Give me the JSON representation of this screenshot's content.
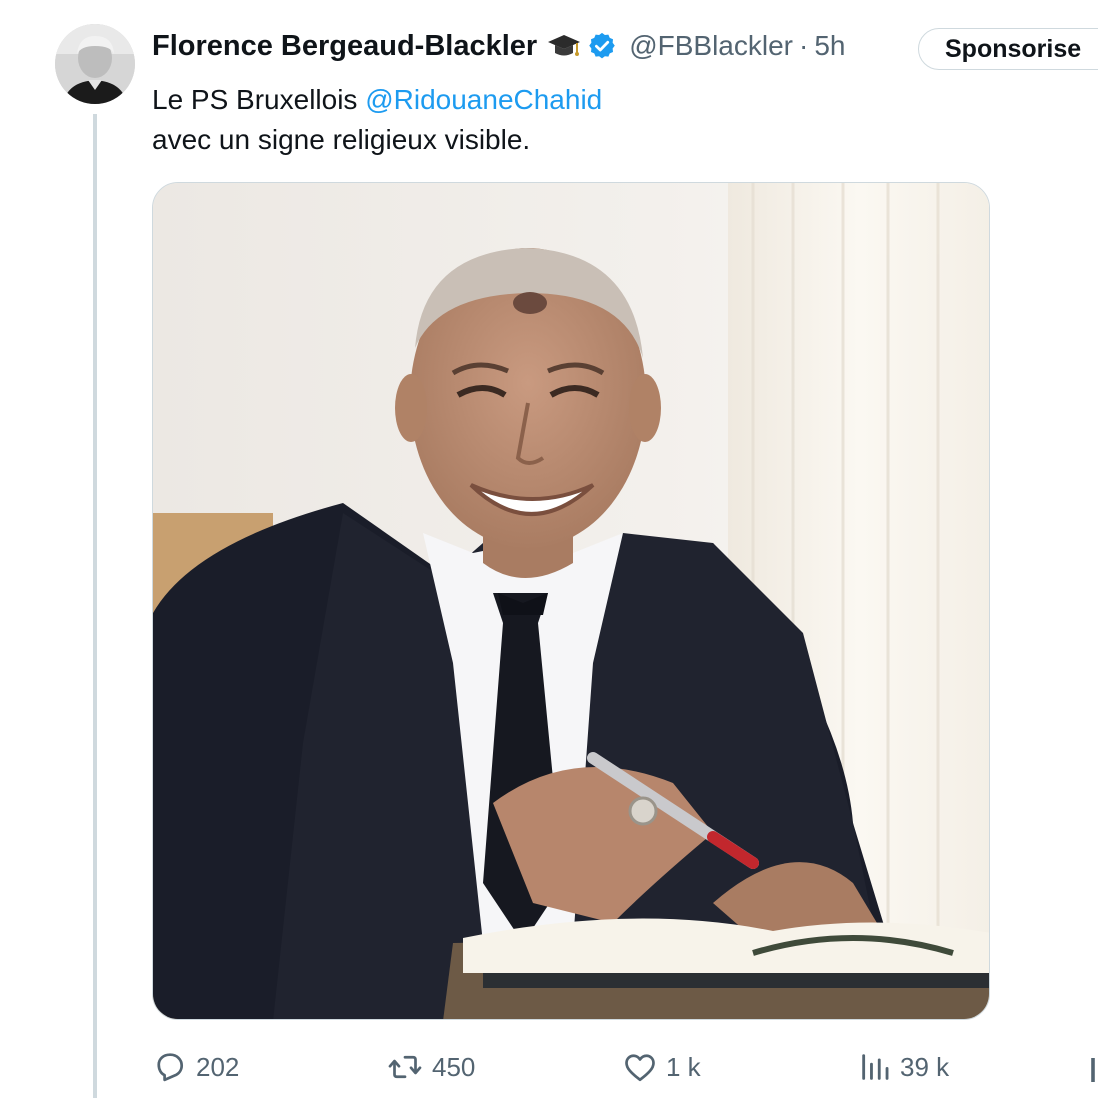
{
  "tweet": {
    "author_name": "Florence Bergeaud-Blackler",
    "handle": "@FBBlackler",
    "separator": "·",
    "time": "5h",
    "sponsor_label": "Sponsorise",
    "text_line1_prefix": "Le PS Bruxellois ",
    "mention": "@RidouaneChahid",
    "text_line2": "avec un signe religieux visible."
  },
  "actions": {
    "replies": "202",
    "retweets": "450",
    "likes": "1 k",
    "views": "39 k"
  },
  "icons": {
    "author_badge": "graduation-cap-icon",
    "verified": "verified-badge-icon",
    "reply": "reply-icon",
    "retweet": "retweet-icon",
    "like": "heart-icon",
    "views": "views-chart-icon",
    "share": "share-icon"
  },
  "colors": {
    "accent": "#1d9bf0",
    "text": "#0f1419",
    "secondary": "#536471",
    "border": "#cfd9de"
  }
}
